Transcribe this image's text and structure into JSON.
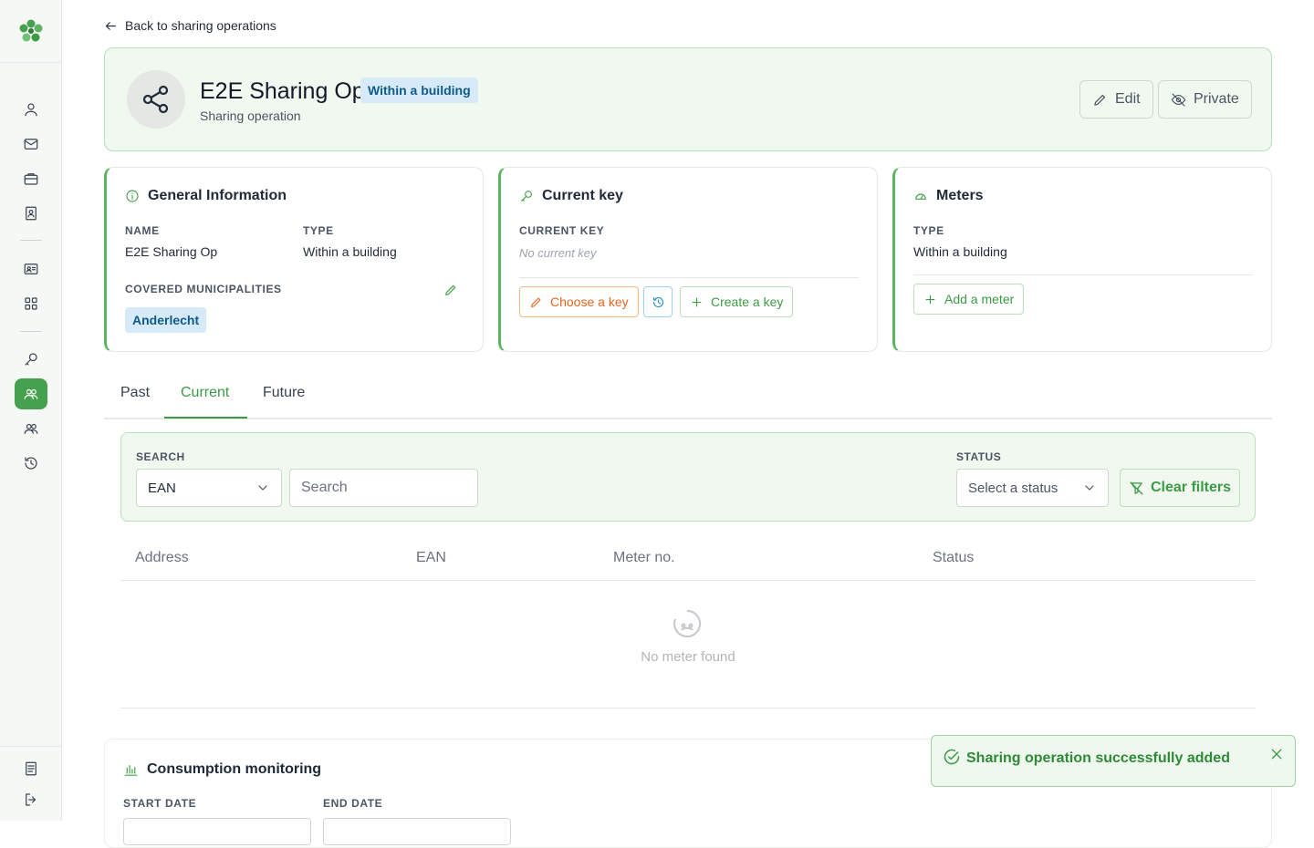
{
  "nav": {
    "back_label": "Back to sharing operations"
  },
  "header": {
    "title": "E2E Sharing Op",
    "badge": "Within a building",
    "subtitle": "Sharing operation",
    "edit_label": "Edit",
    "private_label": "Private"
  },
  "general_info": {
    "title": "General Information",
    "name_label": "NAME",
    "name_value": "E2E Sharing Op",
    "type_label": "TYPE",
    "type_value": "Within a building",
    "municipalities_label": "COVERED MUNICIPALITIES",
    "municipalities": [
      "Anderlecht"
    ]
  },
  "current_key": {
    "title": "Current key",
    "label": "CURRENT KEY",
    "value": "No current key",
    "choose_label": "Choose a key",
    "create_label": "Create a key"
  },
  "meters": {
    "title": "Meters",
    "type_label": "TYPE",
    "type_value": "Within a building",
    "add_label": "Add a meter"
  },
  "tabs": [
    {
      "label": "Past"
    },
    {
      "label": "Current",
      "active": true
    },
    {
      "label": "Future"
    }
  ],
  "filters": {
    "search_label": "SEARCH",
    "search_field": "EAN",
    "search_placeholder": "Search",
    "status_label": "STATUS",
    "status_placeholder": "Select a status",
    "clear_label": "Clear filters"
  },
  "table": {
    "columns": [
      "Address",
      "EAN",
      "Meter no.",
      "Status"
    ],
    "empty_text": "No meter found"
  },
  "consumption": {
    "title": "Consumption monitoring",
    "start_label": "START DATE",
    "end_label": "END DATE"
  },
  "toast": {
    "message": "Sharing operation successfully added"
  },
  "colors": {
    "accent": "#46a14e",
    "badge_bg": "#d6ebf7",
    "badge_text": "#0f5a8a",
    "orange": "#e6661e",
    "blue": "#2a8fc9"
  }
}
